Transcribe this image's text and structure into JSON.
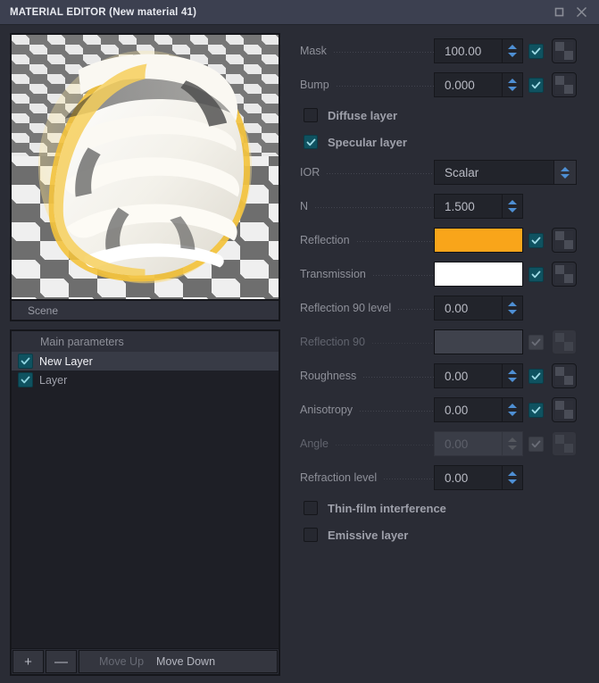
{
  "window": {
    "title": "MATERIAL EDITOR (New material 41)",
    "buttons": [
      {
        "name": "restore-icon",
        "glyph": "square"
      },
      {
        "name": "close-icon",
        "glyph": "x"
      }
    ]
  },
  "preview": {
    "scene_label": "Scene",
    "description": "3D material preview of a white spiral shell object with golden rim light on a checkerboard floor",
    "rim_color": "#f5c243",
    "object_color": "#f6f4ee"
  },
  "layers": {
    "header": "Main parameters",
    "items": [
      {
        "label": "New Layer",
        "checked": true,
        "selected": true
      },
      {
        "label": "Layer",
        "checked": true,
        "selected": false
      }
    ],
    "toolbar": {
      "add_label": "+",
      "remove_label": "—",
      "move_up_label": "Move Up",
      "move_up_enabled": false,
      "move_down_label": "Move Down",
      "move_down_enabled": true
    }
  },
  "parameters": {
    "rows": [
      {
        "label": "Mask",
        "kind": "number",
        "value": "100.00",
        "enabled": true,
        "checkbox": "on",
        "texture": true
      },
      {
        "label": "Bump",
        "kind": "number",
        "value": "0.000",
        "enabled": true,
        "checkbox": "on",
        "texture": true
      },
      {
        "label": "Diffuse layer",
        "kind": "toggle",
        "checked": false
      },
      {
        "label": "Specular layer",
        "kind": "toggle",
        "checked": true
      },
      {
        "label": "IOR",
        "kind": "select",
        "value": "Scalar",
        "enabled": true
      },
      {
        "label": "N",
        "kind": "number",
        "value": "1.500",
        "enabled": true,
        "checkbox": "none",
        "texture": false
      },
      {
        "label": "Reflection",
        "kind": "color",
        "color": "#f9a51a",
        "enabled": true,
        "checkbox": "on",
        "texture": true
      },
      {
        "label": "Transmission",
        "kind": "color",
        "color": "#ffffff",
        "enabled": true,
        "checkbox": "on",
        "texture": true
      },
      {
        "label": "Reflection 90 level",
        "kind": "number",
        "value": "0.00",
        "enabled": true,
        "checkbox": "none",
        "texture": false
      },
      {
        "label": "Reflection 90",
        "kind": "color",
        "color": "#3f424c",
        "enabled": false,
        "checkbox": "dis",
        "texture": true
      },
      {
        "label": "Roughness",
        "kind": "number",
        "value": "0.00",
        "enabled": true,
        "checkbox": "on",
        "texture": true
      },
      {
        "label": "Anisotropy",
        "kind": "number",
        "value": "0.00",
        "enabled": true,
        "checkbox": "on",
        "texture": true
      },
      {
        "label": "Angle",
        "kind": "number",
        "value": "0.00",
        "enabled": false,
        "checkbox": "dis",
        "texture": true
      },
      {
        "label": "Refraction level",
        "kind": "number",
        "value": "0.00",
        "enabled": true,
        "checkbox": "none",
        "texture": false
      },
      {
        "label": "Thin-film interference",
        "kind": "toggle",
        "checked": false
      },
      {
        "label": "Emissive layer",
        "kind": "toggle",
        "checked": false
      }
    ]
  },
  "colors": {
    "titlebar": "#3c4050",
    "panel": "#2a2c35",
    "accent_checkbox": "#0f5260",
    "spinner_arrow": "#4e8fd4",
    "reflection_swatch": "#f9a51a"
  }
}
